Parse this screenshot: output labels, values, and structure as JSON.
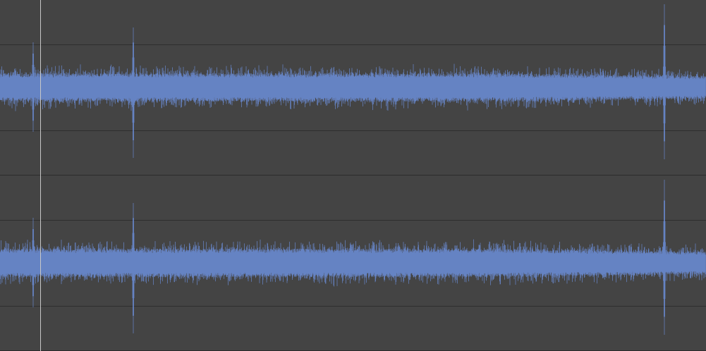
{
  "channels": [
    {
      "kind": "waveform"
    },
    {
      "kind": "waveform"
    }
  ]
}
